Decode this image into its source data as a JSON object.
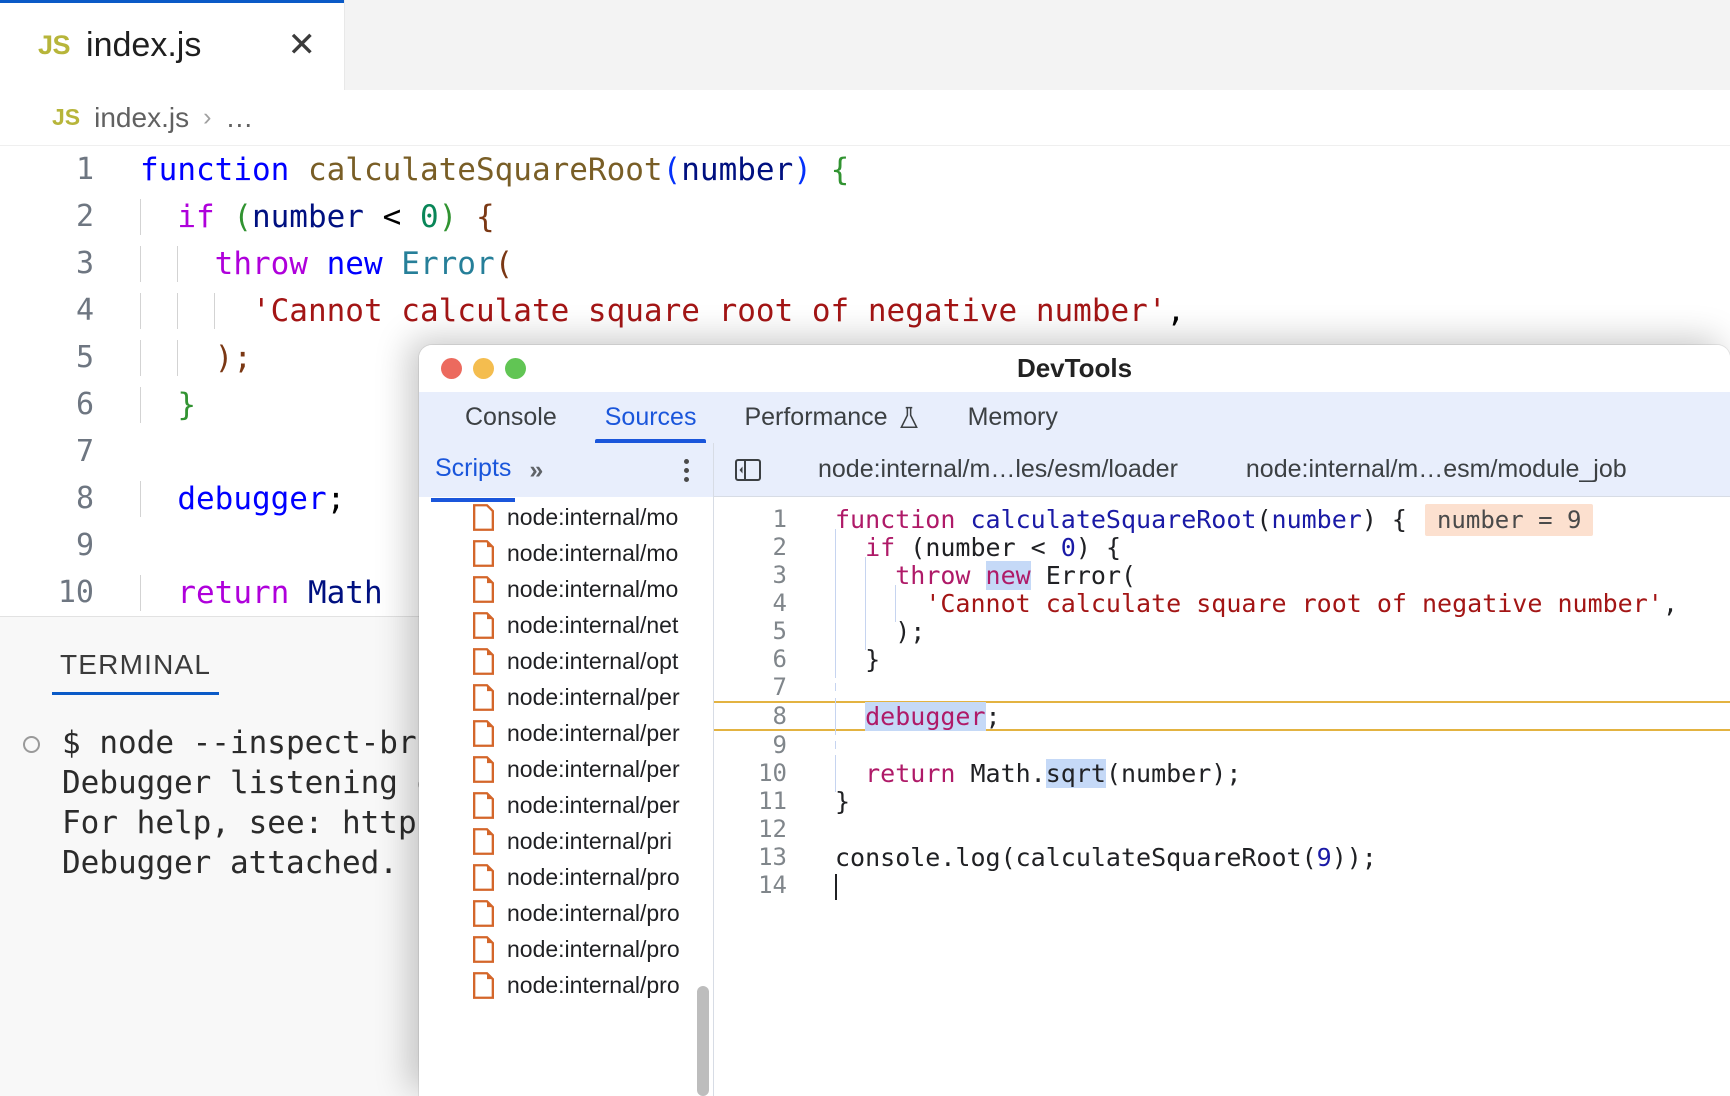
{
  "vscode": {
    "tab": {
      "icon_label": "JS",
      "filename": "index.js",
      "close_icon": "✕"
    },
    "breadcrumb": {
      "icon_label": "JS",
      "filename": "index.js",
      "separator": "›",
      "dots": "…"
    },
    "editor": {
      "lines": [
        {
          "num": "1"
        },
        {
          "num": "2"
        },
        {
          "num": "3"
        },
        {
          "num": "4"
        },
        {
          "num": "5"
        },
        {
          "num": "6"
        },
        {
          "num": "7"
        },
        {
          "num": "8"
        },
        {
          "num": "9"
        },
        {
          "num": "10"
        }
      ],
      "code": {
        "l1_function": "function",
        "l1_name": " calculateSquareRoot",
        "l1_paren_open": "(",
        "l1_param": "number",
        "l1_paren_close": ")",
        "l1_brace": " {",
        "l2_if": "if",
        "l2_paren_open": " (",
        "l2_var": "number",
        "l2_op": " < ",
        "l2_num": "0",
        "l2_paren_close": ")",
        "l2_brace": " {",
        "l3_throw": "throw",
        "l3_new": " new",
        "l3_error": " Error",
        "l3_paren": "(",
        "l4_string": "'Cannot calculate square root of negative number'",
        "l4_comma": ",",
        "l5_text": ");",
        "l6_text": "}",
        "l8_debugger": "debugger",
        "l8_semi": ";",
        "l10_return": "return",
        "l10_math": " Math"
      }
    },
    "terminal": {
      "tab_label": "TERMINAL",
      "lines": [
        {
          "bullet": true,
          "text": "$ node --inspect-br"
        },
        {
          "bullet": false,
          "text": "Debugger listening o"
        },
        {
          "bullet": false,
          "text": "For help, see: https"
        },
        {
          "bullet": false,
          "text": "Debugger attached."
        }
      ]
    }
  },
  "devtools": {
    "window_title": "DevTools",
    "tabs": [
      {
        "label": "Console",
        "active": false,
        "icon": null
      },
      {
        "label": "Sources",
        "active": true,
        "icon": null
      },
      {
        "label": "Performance",
        "active": false,
        "icon": "flask-icon"
      },
      {
        "label": "Memory",
        "active": false,
        "icon": null
      }
    ],
    "navigator": {
      "header_label": "Scripts",
      "overflow_icon": "»",
      "menu_icon": "kebab-menu-icon",
      "files": [
        "node:internal/mo",
        "node:internal/mo",
        "node:internal/mo",
        "node:internal/net",
        "node:internal/opt",
        "node:internal/per",
        "node:internal/per",
        "node:internal/per",
        "node:internal/per",
        "node:internal/pri",
        "node:internal/pro",
        "node:internal/pro",
        "node:internal/pro",
        "node:internal/pro"
      ]
    },
    "source_tabs": [
      {
        "label": "node:internal/m…les/esm/loader"
      },
      {
        "label": "node:internal/m…esm/module_job"
      }
    ],
    "panel_toggle_icon": "collapse-sidebar-icon",
    "source": {
      "lines": [
        {
          "num": "1"
        },
        {
          "num": "2"
        },
        {
          "num": "3"
        },
        {
          "num": "4"
        },
        {
          "num": "5"
        },
        {
          "num": "6"
        },
        {
          "num": "7"
        },
        {
          "num": "8"
        },
        {
          "num": "9"
        },
        {
          "num": "10"
        },
        {
          "num": "11"
        },
        {
          "num": "12"
        },
        {
          "num": "13"
        },
        {
          "num": "14"
        }
      ],
      "code": {
        "l1_function": "function",
        "l1_name": " calculateSquareRoot",
        "l1_paren_open": "(",
        "l1_param": "number",
        "l1_rest": ") {",
        "l1_badge": "number = 9",
        "l2_if": "if",
        "l2_mid": " (number < ",
        "l2_num": "0",
        "l2_rest": ") {",
        "l3_throw": "throw",
        "l3_new": "new",
        "l3_error": " Error(",
        "l4_string": "'Cannot calculate square root of negative number'",
        "l4_comma": ",",
        "l5_text": ");",
        "l6_text": "}",
        "l8_debugger": "debugger",
        "l8_semi": ";",
        "l10_return": "return",
        "l10_math": " Math.",
        "l10_sqrt": "sqrt",
        "l10_rest": "(number);",
        "l11_text": "}",
        "l13_console": "console.log(calculateSquareRoot(",
        "l13_num": "9",
        "l13_rest": "));"
      }
    }
  },
  "colors": {
    "accent_blue": "#1a56db",
    "vscode_tab_underline": "#0a5ac7",
    "paused_line_border": "#e3b341",
    "badge_bg": "#fce0cf",
    "selection_blue": "#c5d9f7",
    "file_icon_orange": "#d4662a",
    "traffic_red": "#ec6a5e",
    "traffic_yellow": "#f4bd4f",
    "traffic_green": "#61c554"
  }
}
